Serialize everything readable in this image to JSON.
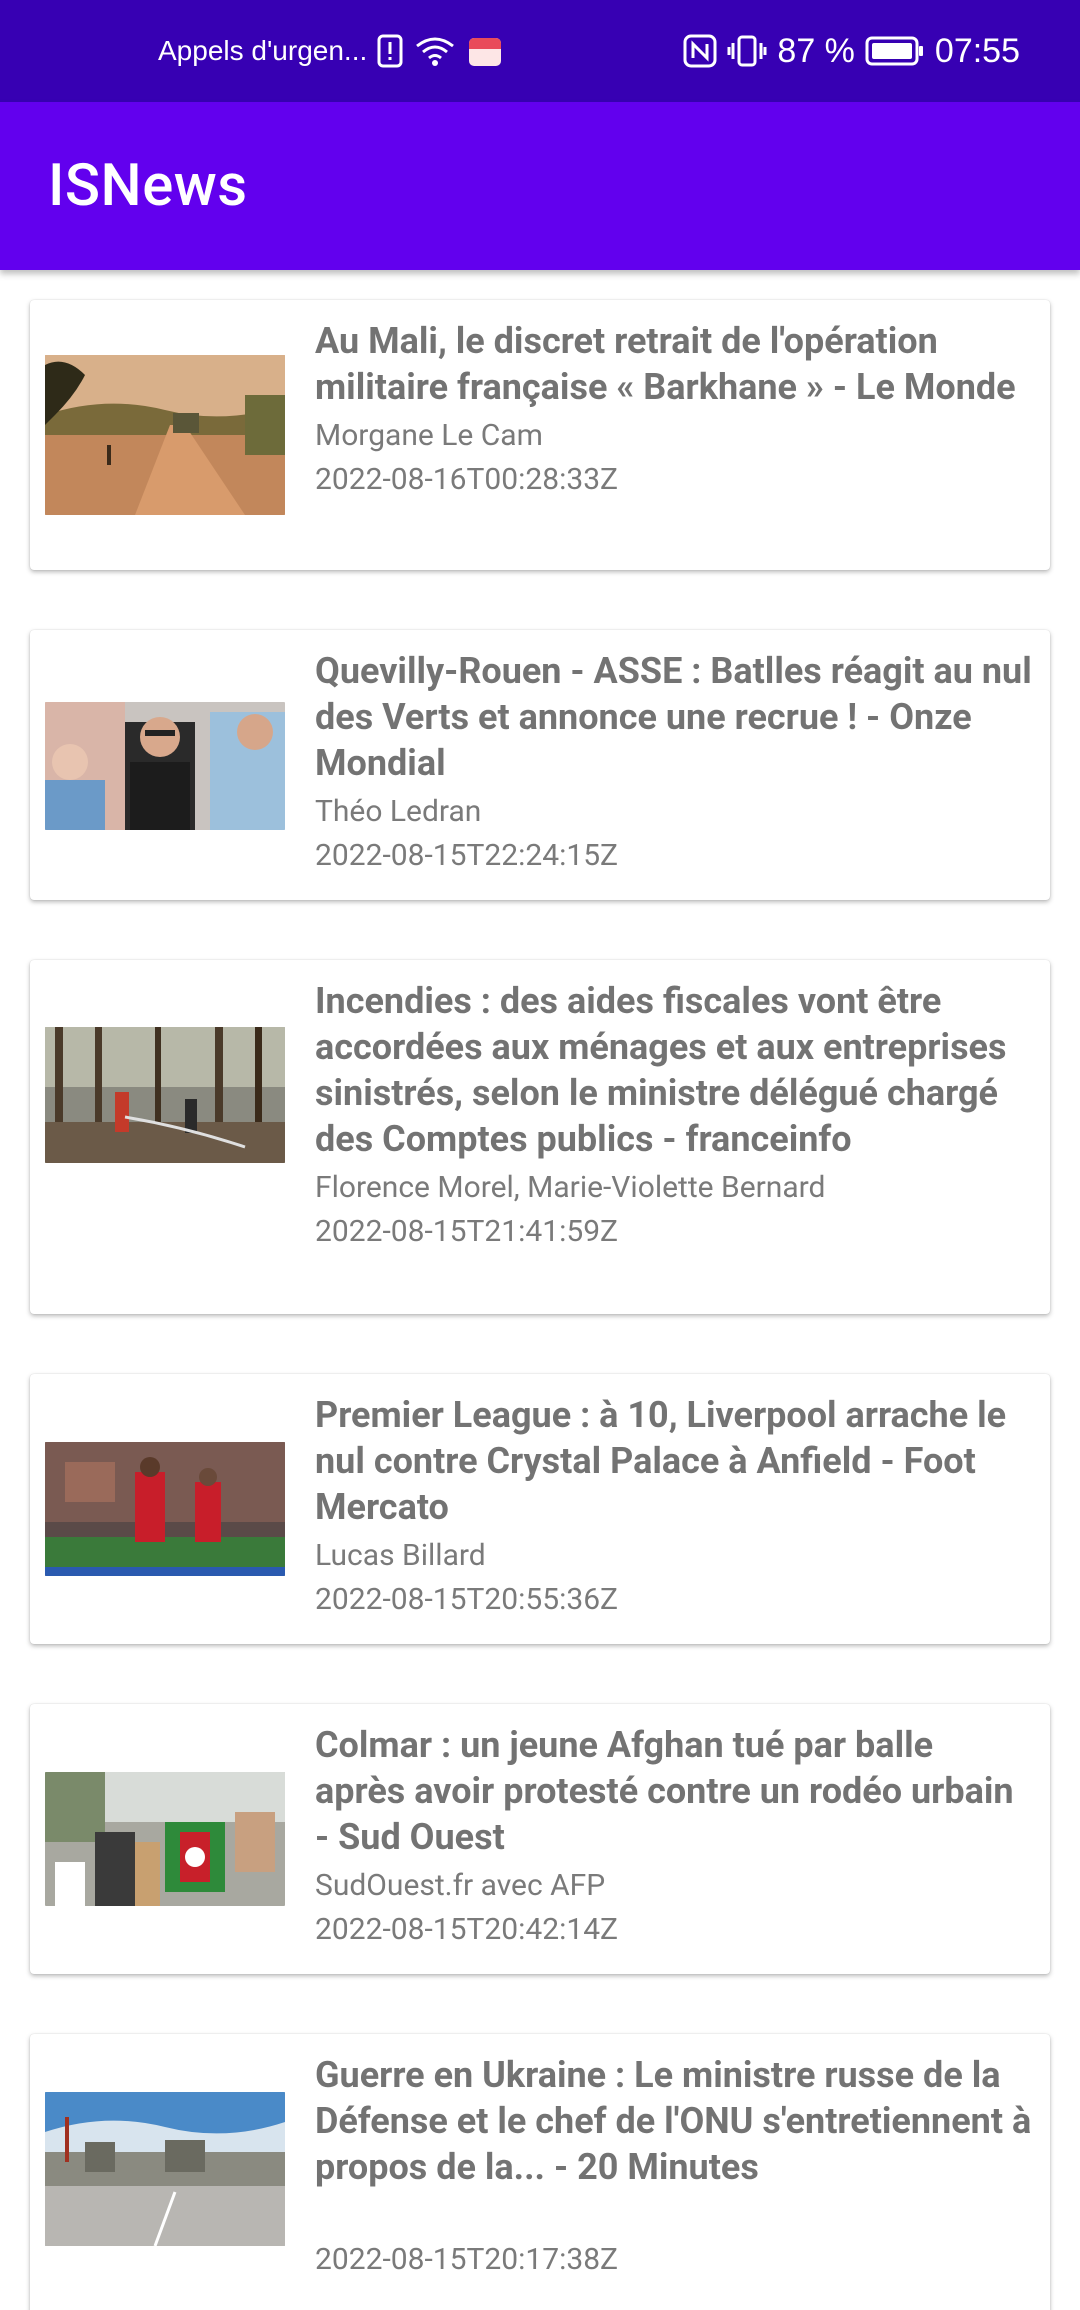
{
  "status_bar": {
    "carrier_text": "Appels d'urgen...",
    "battery_percent": "87 %",
    "time": "07:55",
    "icons": [
      "alert-icon",
      "wifi-icon",
      "calendar-app-icon",
      "nfc-icon",
      "vibrate-icon",
      "battery-icon"
    ]
  },
  "app_bar": {
    "title": "ISNews"
  },
  "articles": [
    {
      "title": "Au Mali, le discret retrait de l'opération militaire française « Barkhane » - Le Monde",
      "author": "Morgane Le Cam",
      "published": "2022-08-16T00:28:33Z"
    },
    {
      "title": "Quevilly-Rouen - ASSE : Batlles réagit au nul des Verts et annonce une recrue ! - Onze Mondial",
      "author": "Théo Ledran",
      "published": "2022-08-15T22:24:15Z"
    },
    {
      "title": "Incendies : des aides fiscales vont être accordées aux ménages et aux entreprises sinistrés, selon le ministre délégué chargé des Comptes publics - franceinfo",
      "author": "Florence Morel, Marie-Violette Bernard",
      "published": "2022-08-15T21:41:59Z"
    },
    {
      "title": "Premier League : à 10, Liverpool arrache le nul contre Crystal Palace à Anfield - Foot Mercato",
      "author": "Lucas Billard",
      "published": "2022-08-15T20:55:36Z"
    },
    {
      "title": "Colmar : un jeune Afghan tué par balle après avoir protesté contre un rodéo urbain - Sud Ouest",
      "author": "SudOuest.fr avec AFP",
      "published": "2022-08-15T20:42:14Z"
    },
    {
      "title": "Guerre en Ukraine : Le ministre russe de la Défense et le chef de l'ONU s'entretiennent à propos de la... - 20 Minutes",
      "author": "",
      "published": "2022-08-15T20:17:38Z"
    }
  ],
  "colors": {
    "status_bar": "#3700b3",
    "app_bar": "#6200ee",
    "text_gray": "#757575"
  }
}
